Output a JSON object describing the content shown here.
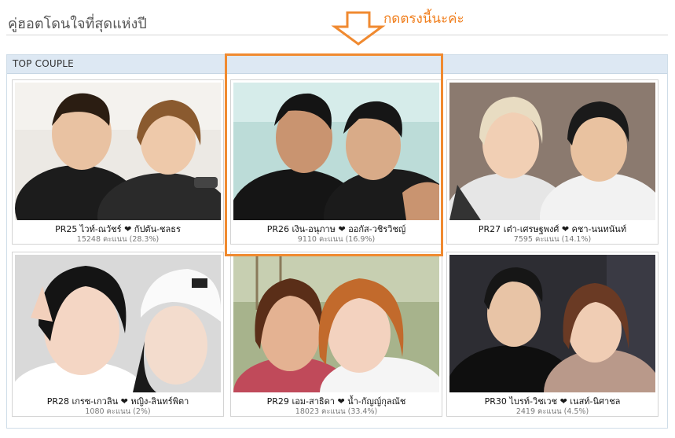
{
  "page": {
    "title": "คู่ฮอตโดนใจที่สุดแห่งปี",
    "annotation": "กดตรงนี้นะค่ะ"
  },
  "panel": {
    "header": "TOP COUPLE"
  },
  "couples": [
    {
      "code": "PR25",
      "name1": "ไวท์-ณวัชร์",
      "name2": "กัปตัน-ชลธร",
      "votes": "15248 คะแนน (28.3%)"
    },
    {
      "code": "PR26",
      "name1": "เงิน-อนุภาษ",
      "name2": "ออกัส-วชิรวิชญ์",
      "votes": "9110 คะแนน (16.9%)"
    },
    {
      "code": "PR27",
      "name1": "เต๋า-เศรษฐพงศ์",
      "name2": "คชา-นนทนันท์",
      "votes": "7595 คะแนน (14.1%)"
    },
    {
      "code": "PR28",
      "name1": "เกรซ-เกวลิน",
      "name2": "หญิง-ลินทร์พิตา",
      "votes": "1080 คะแนน (2%)"
    },
    {
      "code": "PR29",
      "name1": "เอม-สาธิดา",
      "name2": "น้ำ-กัญญ์กุลณัช",
      "votes": "18023 คะแนน (33.4%)"
    },
    {
      "code": "PR30",
      "name1": "ไบรท์-วิชเวช",
      "name2": "เนสท์-นิศาชล",
      "votes": "2419 คะแนน (4.5%)"
    }
  ],
  "heart_symbol": "❤",
  "colors": {
    "accent_orange": "#f08a30",
    "panel_header_bg": "#dde8f3",
    "title_text": "#555555"
  }
}
